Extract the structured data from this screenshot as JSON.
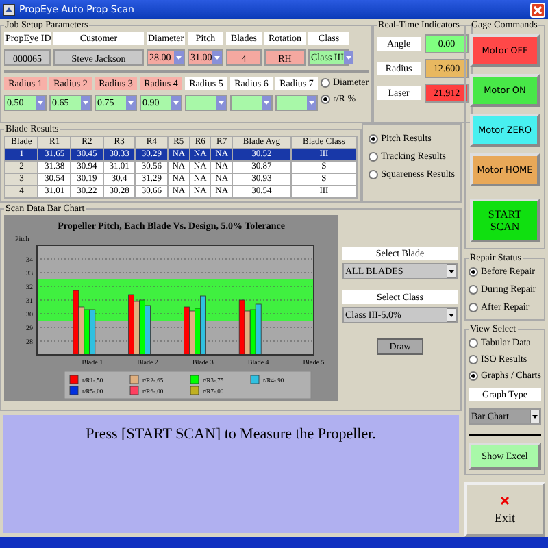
{
  "window": {
    "title": "PropEye Auto Prop Scan"
  },
  "job_setup": {
    "title": "Job Setup Parameters",
    "fields": [
      {
        "label": "PropEye ID",
        "value": "000065",
        "kind": "text",
        "color": "#c8c8c8"
      },
      {
        "label": "Customer",
        "value": "Steve Jackson",
        "kind": "text",
        "color": "#c8c8c8"
      },
      {
        "label": "Diameter",
        "value": "28.00",
        "kind": "dropdown",
        "color": "#f4a8a0"
      },
      {
        "label": "Pitch",
        "value": "31.00",
        "kind": "dropdown",
        "color": "#f4a8a0"
      },
      {
        "label": "Blades",
        "value": "4",
        "kind": "text",
        "color": "#f4a8a0"
      },
      {
        "label": "Rotation",
        "value": "RH",
        "kind": "text",
        "color": "#f4a8a0"
      },
      {
        "label": "Class",
        "value": "Class III",
        "kind": "dropdown",
        "color": "#a0f4a0"
      }
    ],
    "radii": [
      {
        "label": "Radius 1",
        "value": "0.50",
        "set": true
      },
      {
        "label": "Radius 2",
        "value": "0.65",
        "set": true
      },
      {
        "label": "Radius 3",
        "value": "0.75",
        "set": true
      },
      {
        "label": "Radius 4",
        "value": "0.90",
        "set": true
      },
      {
        "label": "Radius 5",
        "set": false
      },
      {
        "label": "Radius 6",
        "set": false
      },
      {
        "label": "Radius 7",
        "set": false
      }
    ],
    "radius_mode": [
      {
        "label": "Diameter",
        "selected": false
      },
      {
        "label": "r/R %",
        "selected": true
      }
    ]
  },
  "indicators": {
    "title": "Real-Time Indicators",
    "items": [
      {
        "label": "Angle",
        "value": "0.00",
        "color": "#80ff80"
      },
      {
        "label": "Radius",
        "value": "12.600",
        "color": "#e8b860"
      },
      {
        "label": "Laser",
        "value": "21.912",
        "color": "#ff4040"
      }
    ]
  },
  "blade_results": {
    "title": "Blade Results",
    "columns": [
      "Blade",
      "R1",
      "R2",
      "R3",
      "R4",
      "R5",
      "R6",
      "R7",
      "Blade Avg",
      "Blade Class"
    ],
    "rows": [
      {
        "cells": [
          "1",
          "31.65",
          "30.45",
          "30.33",
          "30.29",
          "NA",
          "NA",
          "NA",
          "30.52",
          "III"
        ],
        "selected": true
      },
      {
        "cells": [
          "2",
          "31.38",
          "30.94",
          "31.01",
          "30.56",
          "NA",
          "NA",
          "NA",
          "30.87",
          "S"
        ],
        "selected": false
      },
      {
        "cells": [
          "3",
          "30.54",
          "30.19",
          "30.4",
          "31.29",
          "NA",
          "NA",
          "NA",
          "30.93",
          "S"
        ],
        "selected": false
      },
      {
        "cells": [
          "4",
          "31.01",
          "30.22",
          "30.28",
          "30.66",
          "NA",
          "NA",
          "NA",
          "30.54",
          "III"
        ],
        "selected": false
      }
    ],
    "result_type": [
      {
        "label": "Pitch Results",
        "selected": true
      },
      {
        "label": "Tracking Results",
        "selected": false
      },
      {
        "label": "Squareness Results",
        "selected": false
      }
    ]
  },
  "chart": {
    "title": "Scan Data Bar Chart",
    "chart_data": {
      "type": "bar",
      "title": "Propeller Pitch, Each Blade Vs. Design, 5.0% Tolerance",
      "ylabel": "Pitch",
      "categories": [
        "Blade 1",
        "Blade 2",
        "Blade 3",
        "Blade 4",
        "Blade 5"
      ],
      "series": [
        {
          "name": "r/R1-.50",
          "color": "#ff0000",
          "values": [
            31.7,
            31.4,
            30.5,
            31.0,
            null
          ]
        },
        {
          "name": "r/R2-.65",
          "color": "#e0b080",
          "values": [
            30.5,
            30.9,
            30.2,
            30.2,
            null
          ]
        },
        {
          "name": "r/R3-.75",
          "color": "#00ff00",
          "values": [
            30.3,
            31.0,
            30.4,
            30.3,
            null
          ]
        },
        {
          "name": "r/R4-.90",
          "color": "#30c0e0",
          "values": [
            30.3,
            30.6,
            31.3,
            30.7,
            null
          ]
        },
        {
          "name": "r/R5-.00",
          "color": "#0030e0",
          "values": [
            null,
            null,
            null,
            null,
            null
          ]
        },
        {
          "name": "r/R6-.00",
          "color": "#ff4060",
          "values": [
            null,
            null,
            null,
            null,
            null
          ]
        },
        {
          "name": "r/R7-.00",
          "color": "#c0b020",
          "values": [
            null,
            null,
            null,
            null,
            null
          ]
        }
      ],
      "ylim": [
        27,
        35
      ],
      "yticks": [
        28,
        29,
        30,
        31,
        32,
        33,
        34
      ],
      "grid": true,
      "legend": true,
      "bands": [
        {
          "axis": "y",
          "from": 29.45,
          "to": 32.55,
          "color": "#40f040"
        }
      ]
    },
    "select_blade_label": "Select Blade",
    "select_blade": "ALL BLADES",
    "select_class_label": "Select Class",
    "select_class": "Class III-5.0%",
    "draw_button": "Draw"
  },
  "message": "Press [START SCAN] to Measure the Propeller.",
  "gage_commands": {
    "title": "Gage Commands",
    "buttons": [
      {
        "label": "Motor OFF",
        "color": "#ff4848",
        "kind": "motor"
      },
      {
        "label": "Motor ON",
        "color": "#48e848",
        "kind": "motor"
      },
      {
        "label": "Motor ZERO",
        "color": "#48f0f0",
        "kind": "motor"
      },
      {
        "label": "Motor HOME",
        "color": "#e8a858",
        "kind": "motor"
      },
      {
        "label": "START SCAN",
        "color": "#10e010",
        "kind": "scan"
      }
    ]
  },
  "repair_status": {
    "title": "Repair Status",
    "options": [
      {
        "label": "Before Repair",
        "selected": true
      },
      {
        "label": "During Repair",
        "selected": false
      },
      {
        "label": "After Repair",
        "selected": false
      }
    ]
  },
  "view_select": {
    "title": "View Select",
    "options": [
      {
        "label": "Tabular Data",
        "selected": false
      },
      {
        "label": "ISO Results",
        "selected": false
      },
      {
        "label": "Graphs / Charts",
        "selected": true
      }
    ],
    "graph_type_label": "Graph Type",
    "graph_type": "Bar Chart",
    "show_excel": "Show Excel"
  },
  "exit_button": "Exit"
}
